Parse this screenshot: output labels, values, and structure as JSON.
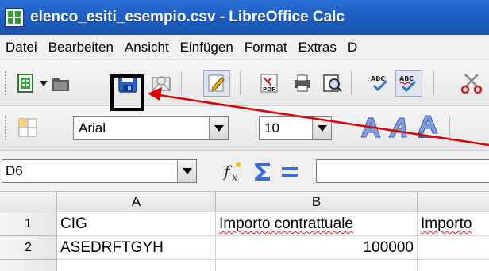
{
  "window": {
    "title": "elenco_esiti_esempio.csv - LibreOffice Calc"
  },
  "menu": {
    "items": [
      {
        "label": "Datei"
      },
      {
        "label": "Bearbeiten"
      },
      {
        "label": "Ansicht"
      },
      {
        "label": "Einfügen"
      },
      {
        "label": "Format"
      },
      {
        "label": "Extras"
      },
      {
        "label": "D"
      }
    ]
  },
  "format_toolbar": {
    "font_name": "Arial",
    "font_size": "10"
  },
  "formula_bar": {
    "name_box": "D6",
    "formula": ""
  },
  "sheet": {
    "columns": [
      "A",
      "B"
    ],
    "rows": [
      {
        "num": "1",
        "a": "CIG",
        "b": "Importo contrattuale",
        "c": "Importo"
      },
      {
        "num": "2",
        "a": "ASEDRFTGYH",
        "b": "100000",
        "c": ""
      }
    ]
  },
  "annotation": {
    "color": "#e00000"
  }
}
